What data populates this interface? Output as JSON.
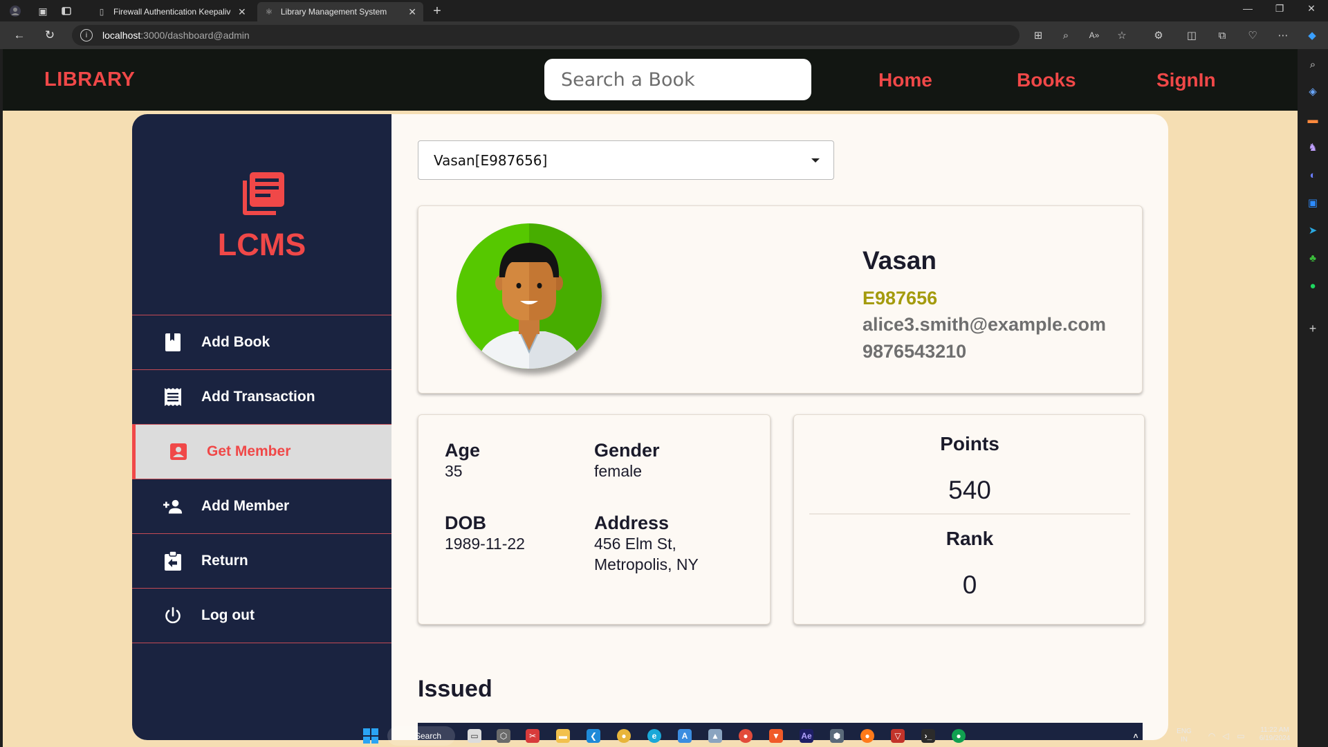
{
  "browser": {
    "tabs": [
      {
        "title": "Firewall Authentication Keepalive",
        "active": false
      },
      {
        "title": "Library Management System",
        "active": true
      }
    ],
    "url_host": "localhost",
    "url_path": ":3000/dashboard@admin"
  },
  "navbar": {
    "brand": "LIBRARY",
    "search_placeholder": "Search a Book",
    "links": [
      "Home",
      "Books",
      "SignIn"
    ]
  },
  "sidebar": {
    "logo_text": "LCMS",
    "items": [
      {
        "label": "Add Book",
        "icon": "book-icon",
        "active": false
      },
      {
        "label": "Add Transaction",
        "icon": "receipt-icon",
        "active": false
      },
      {
        "label": "Get Member",
        "icon": "contact-card-icon",
        "active": true
      },
      {
        "label": "Add Member",
        "icon": "person-add-icon",
        "active": false
      },
      {
        "label": "Return",
        "icon": "assignment-return-icon",
        "active": false
      },
      {
        "label": "Log out",
        "icon": "power-icon",
        "active": false
      }
    ]
  },
  "member_select": {
    "value": "Vasan[E987656]"
  },
  "profile": {
    "name": "Vasan",
    "id": "E987656",
    "email": "alice3.smith@example.com",
    "phone": "9876543210"
  },
  "details": {
    "age_label": "Age",
    "age": "35",
    "gender_label": "Gender",
    "gender": "female",
    "dob_label": "DOB",
    "dob": "1989-11-22",
    "address_label": "Address",
    "address_line1": "456 Elm St,",
    "address_line2": "Metropolis, NY"
  },
  "stats": {
    "points_label": "Points",
    "points": "540",
    "rank_label": "Rank",
    "rank": "0"
  },
  "issued": {
    "heading": "Issued"
  },
  "taskbar": {
    "search_label": "Search",
    "lang_line1": "ENG",
    "lang_line2": "IN",
    "time": "11:22 AM",
    "date": "6/19/2024"
  },
  "colors": {
    "accent": "#f04848",
    "sidebar": "#1a2340",
    "page_bg": "#f5deb3",
    "nav_bg": "#121612"
  }
}
